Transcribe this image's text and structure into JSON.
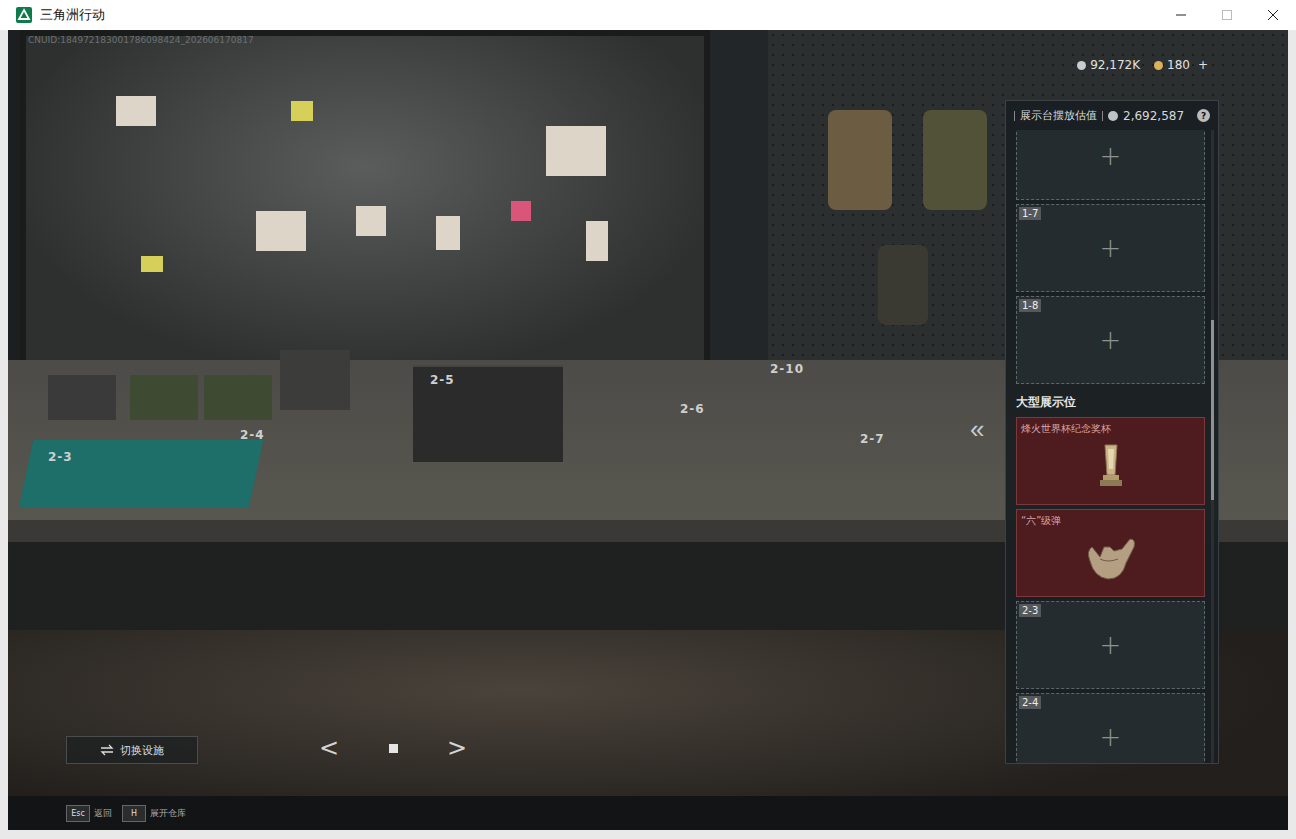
{
  "window": {
    "title": "三角洲行动"
  },
  "uid": "CNUID:184972183001786098424_202606170817",
  "currency": [
    {
      "amount": "92,172K",
      "action": "",
      "color": "#c9ccd0"
    },
    {
      "amount": "180",
      "action": "+",
      "color": "#d9b25a"
    }
  ],
  "scene_labels": [
    "2-3",
    "2-4",
    "2-5",
    "2-6",
    "2-7",
    "2-10"
  ],
  "display_panel": {
    "title": "展示台摆放估值",
    "value": "2,692,587",
    "help": "?",
    "collapse": "«",
    "sections": [
      {
        "heading": "",
        "slots": [
          {
            "kind": "empty",
            "label": "",
            "add": "+"
          },
          {
            "kind": "empty",
            "label": "1-7",
            "add": "+"
          },
          {
            "kind": "empty",
            "label": "1-8",
            "add": "+"
          }
        ]
      },
      {
        "heading": "大型展示位",
        "slots": [
          {
            "kind": "item",
            "label": "烽火世界杯纪念奖杯",
            "add": ""
          },
          {
            "kind": "item",
            "label": "“六”级弹",
            "add": ""
          },
          {
            "kind": "empty",
            "label": "2-3",
            "add": "+"
          },
          {
            "kind": "empty",
            "label": "2-4",
            "add": "+"
          }
        ]
      }
    ]
  },
  "switch_button": {
    "label": "切换设施"
  },
  "pager": {
    "prev": "<",
    "next": ">",
    "pages": [
      {
        "selected": true
      }
    ]
  },
  "footer": [
    {
      "key": "Esc",
      "label": "返回"
    },
    {
      "key": "H",
      "label": "展开仓库"
    }
  ]
}
